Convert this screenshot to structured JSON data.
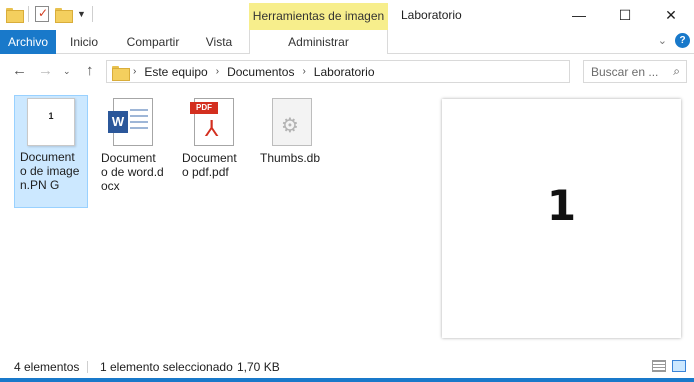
{
  "window": {
    "title": "Laboratorio",
    "context_tab_group": "Herramientas de imagen",
    "minimize_icon": "—",
    "maximize_icon": "☐",
    "close_icon": "✕"
  },
  "ribbon": {
    "tabs": [
      {
        "label": "Archivo"
      },
      {
        "label": "Inicio"
      },
      {
        "label": "Compartir"
      },
      {
        "label": "Vista"
      },
      {
        "label": "Administrar"
      }
    ]
  },
  "address": {
    "crumbs": [
      "Este equipo",
      "Documentos",
      "Laboratorio"
    ],
    "search_placeholder": "Buscar en ..."
  },
  "files": [
    {
      "name": "Documento de imagen.PNG",
      "label": "Document o de imagen.PN G",
      "thumb_text": "1",
      "selected": true,
      "type": "png"
    },
    {
      "name": "Documento de word.docx",
      "label": "Document o de word.docx",
      "selected": false,
      "type": "docx"
    },
    {
      "name": "Documento pdf.pdf",
      "label": "Document o pdf.pdf",
      "pdf_badge": "PDF",
      "selected": false,
      "type": "pdf"
    },
    {
      "name": "Thumbs.db",
      "label": "Thumbs.db",
      "selected": false,
      "type": "db"
    }
  ],
  "preview": {
    "content": "1"
  },
  "status": {
    "count": "4 elementos",
    "selection": "1 elemento seleccionado",
    "size": "1,70 KB"
  },
  "colors": {
    "accent": "#1979ca",
    "context_tab": "#f7ee8c",
    "selection": "#cce8ff"
  }
}
